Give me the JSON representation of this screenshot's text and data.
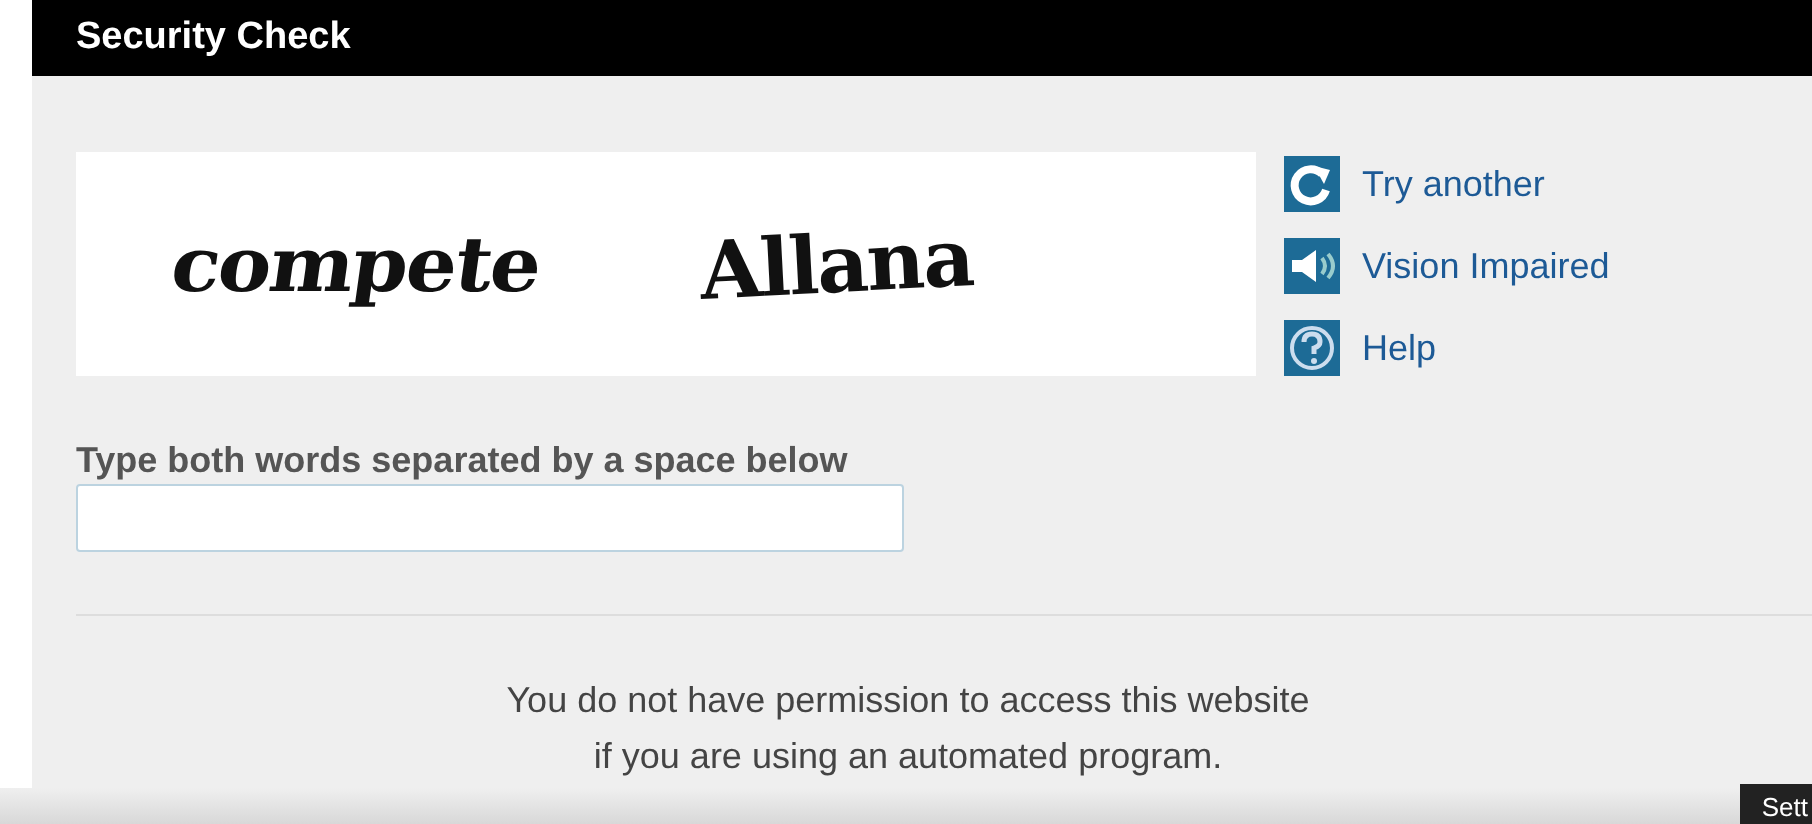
{
  "header": {
    "title": "Security Check"
  },
  "captcha": {
    "words": [
      "compete",
      "Allana"
    ]
  },
  "links": [
    {
      "kind": "refresh",
      "label": "Try another"
    },
    {
      "kind": "audio",
      "label": "Vision Impaired"
    },
    {
      "kind": "help",
      "label": "Help"
    }
  ],
  "answer": {
    "label": "Type both words separated by a space below"
  },
  "notice": {
    "lines": [
      "You do not have permission to access this website",
      "if you are using an automated program."
    ]
  },
  "player_overlay": {
    "label": "Sett"
  }
}
